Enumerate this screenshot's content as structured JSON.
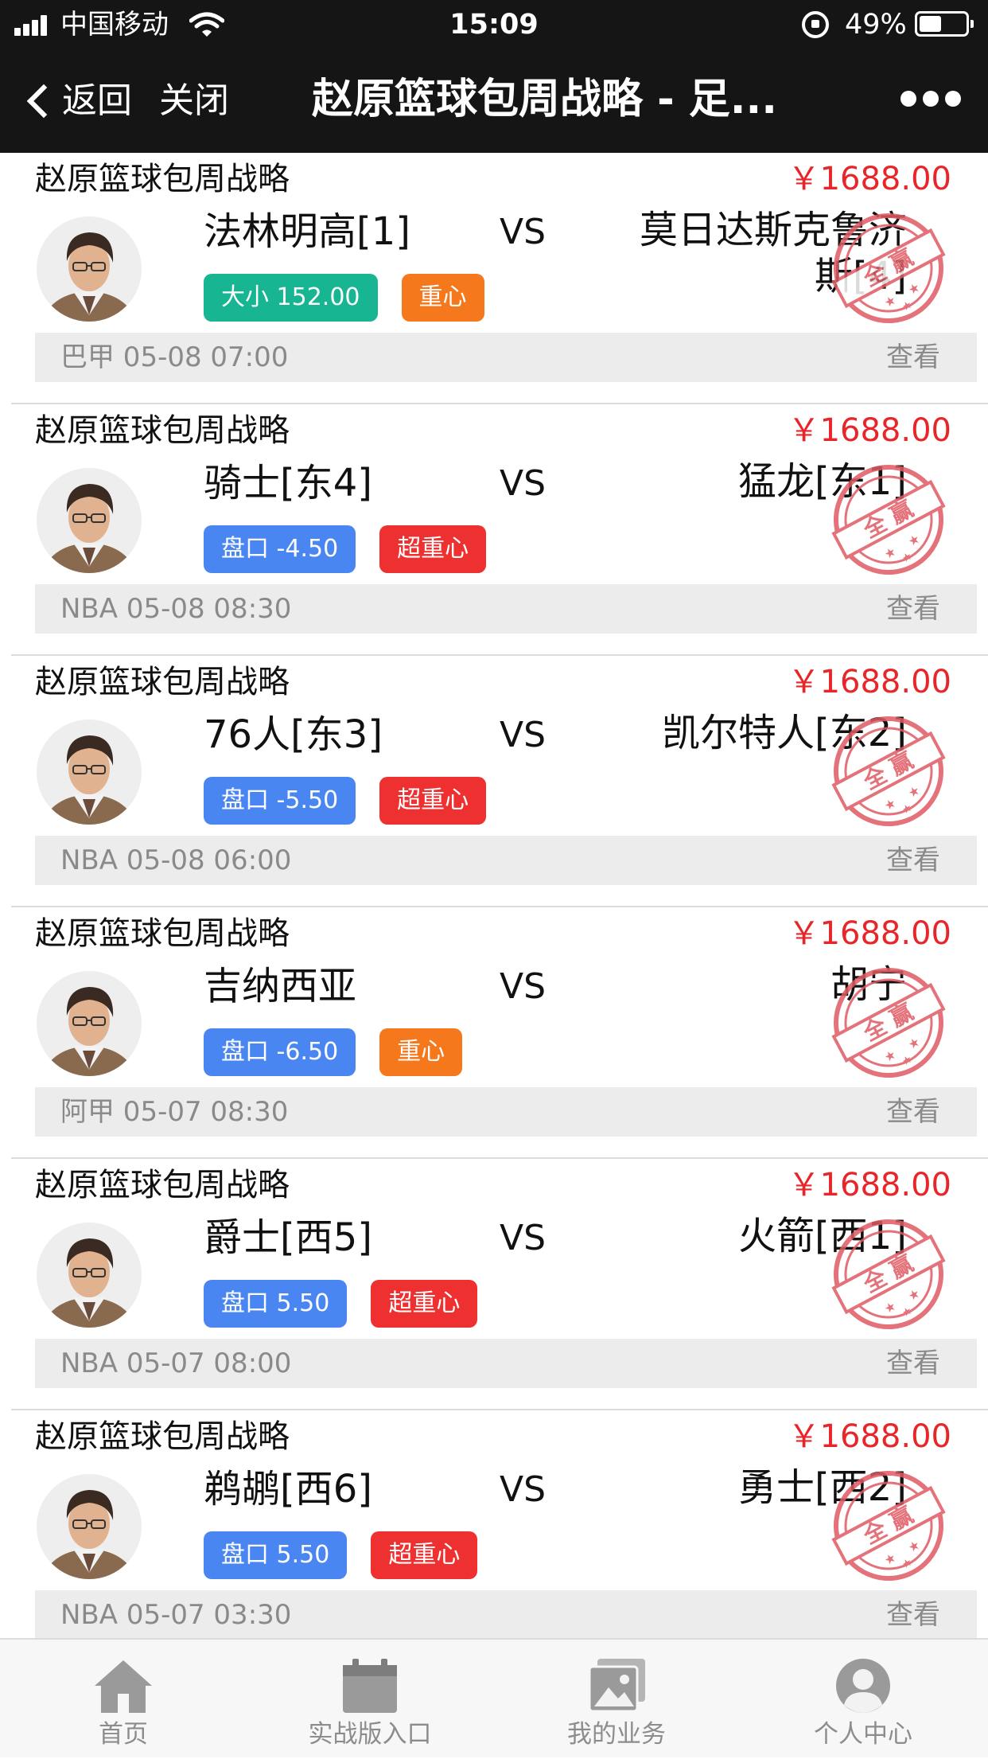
{
  "status_bar": {
    "carrier": "中国移动",
    "time": "15:09",
    "battery_pct": "49%",
    "battery_level": 0.49,
    "signal_bars": 4
  },
  "nav": {
    "back_label": "返回",
    "close_label": "关闭",
    "title": "赵原篮球包周战略 - 足..."
  },
  "colors": {
    "price": "#e8262a",
    "tag_blue": "#4a86f2",
    "tag_teal": "#17b591",
    "tag_red": "#ee3030",
    "tag_orange": "#f5781c",
    "stamp": "#e05a63"
  },
  "stamp_text": "全 赢",
  "cards": [
    {
      "title": "赵原篮球包周战略",
      "price": "￥1688.00",
      "home": "法林明高[1]",
      "vs": "VS",
      "away": "莫日达斯克鲁济斯[4]",
      "odds": "大小 152.00",
      "odds_style": "teal",
      "level": "重心",
      "level_style": "orange",
      "info": "巴甲 05-08 07:00",
      "view": "查看"
    },
    {
      "title": "赵原篮球包周战略",
      "price": "￥1688.00",
      "home": "骑士[东4]",
      "vs": "VS",
      "away": "猛龙[东1]",
      "odds": "盘口 -4.50",
      "odds_style": "blue",
      "level": "超重心",
      "level_style": "red",
      "info": "NBA 05-08 08:30",
      "view": "查看"
    },
    {
      "title": "赵原篮球包周战略",
      "price": "￥1688.00",
      "home": "76人[东3]",
      "vs": "VS",
      "away": "凯尔特人[东2]",
      "odds": "盘口 -5.50",
      "odds_style": "blue",
      "level": "超重心",
      "level_style": "red",
      "info": "NBA 05-08 06:00",
      "view": "查看"
    },
    {
      "title": "赵原篮球包周战略",
      "price": "￥1688.00",
      "home": "吉纳西亚",
      "vs": "VS",
      "away": "胡宁",
      "odds": "盘口 -6.50",
      "odds_style": "blue",
      "level": "重心",
      "level_style": "orange",
      "info": "阿甲 05-07 08:30",
      "view": "查看"
    },
    {
      "title": "赵原篮球包周战略",
      "price": "￥1688.00",
      "home": "爵士[西5]",
      "vs": "VS",
      "away": "火箭[西1]",
      "odds": "盘口 5.50",
      "odds_style": "blue",
      "level": "超重心",
      "level_style": "red",
      "info": "NBA 05-07 08:00",
      "view": "查看"
    },
    {
      "title": "赵原篮球包周战略",
      "price": "￥1688.00",
      "home": "鹈鹕[西6]",
      "vs": "VS",
      "away": "勇士[西2]",
      "odds": "盘口 5.50",
      "odds_style": "blue",
      "level": "超重心",
      "level_style": "red",
      "info": "NBA 05-07 03:30",
      "view": "查看"
    }
  ],
  "tabbar": [
    {
      "label": "首页",
      "icon": "home-icon"
    },
    {
      "label": "实战版入口",
      "icon": "calendar-icon"
    },
    {
      "label": "我的业务",
      "icon": "gallery-icon"
    },
    {
      "label": "个人中心",
      "icon": "person-icon"
    }
  ]
}
